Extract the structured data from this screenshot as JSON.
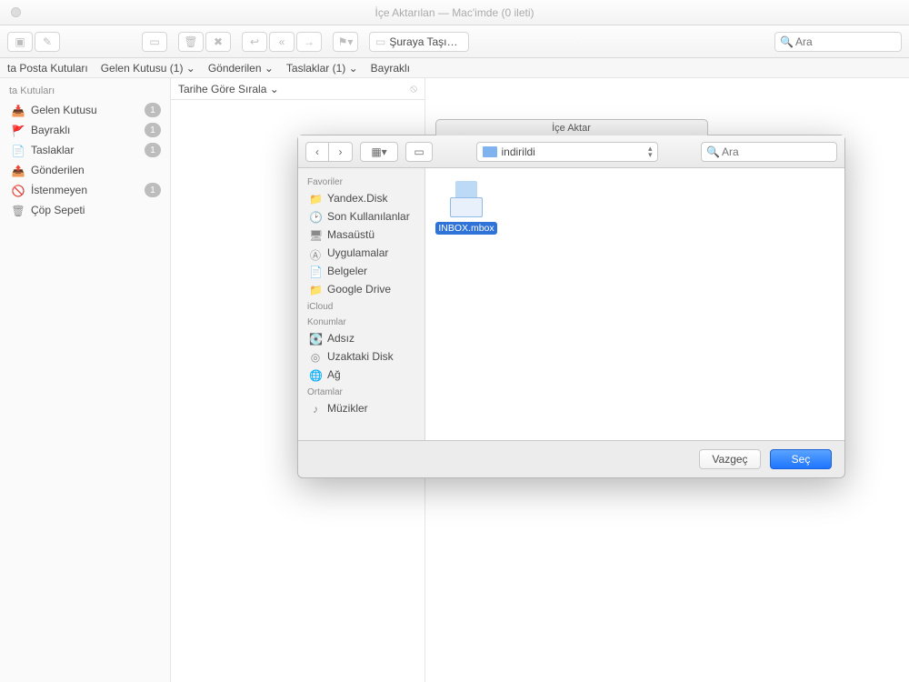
{
  "window": {
    "title": "İçe Aktarılan — Mac'imde (0 ileti)"
  },
  "toolbar": {
    "search_placeholder": "Ara"
  },
  "favbar": {
    "items": [
      "ta Posta Kutuları",
      "Gelen Kutusu (1) ⌄",
      "Gönderilen ⌄",
      "Taslaklar (1) ⌄",
      "Bayraklı"
    ]
  },
  "sidebar": {
    "header": "ta Kutuları",
    "items": [
      {
        "icon": "📥",
        "label": "Gelen Kutusu",
        "badge": "1"
      },
      {
        "icon": "🚩",
        "label": "Bayraklı",
        "badge": "1"
      },
      {
        "icon": "📄",
        "label": "Taslaklar",
        "badge": "1"
      },
      {
        "icon": "📤",
        "label": "Gönderilen",
        "badge": ""
      },
      {
        "icon": "🚫",
        "label": "İstenmeyen",
        "badge": "1"
      },
      {
        "icon": "🗑",
        "label": "Çöp Sepeti",
        "badge": ""
      }
    ]
  },
  "msglist": {
    "sort_label": "Tarihe Göre Sırala ⌄"
  },
  "move_placeholder": "Şuraya Taşı…",
  "dialog": {
    "title": "İçe Aktar",
    "folder": "indirildi",
    "search_placeholder": "Ara",
    "sections": [
      {
        "title": "Favoriler",
        "items": [
          {
            "icon": "📁",
            "label": "Yandex.Disk"
          },
          {
            "icon": "🕑",
            "label": "Son Kullanılanlar"
          },
          {
            "icon": "🖥",
            "label": "Masaüstü"
          },
          {
            "icon": "Ⓐ",
            "label": "Uygulamalar"
          },
          {
            "icon": "📄",
            "label": "Belgeler"
          },
          {
            "icon": "📁",
            "label": "Google Drive"
          }
        ]
      },
      {
        "title": "iCloud",
        "items": []
      },
      {
        "title": "Konumlar",
        "items": [
          {
            "icon": "💽",
            "label": "Adsız"
          },
          {
            "icon": "◎",
            "label": "Uzaktaki Disk"
          },
          {
            "icon": "🌐",
            "label": "Ağ"
          }
        ]
      },
      {
        "title": "Ortamlar",
        "items": [
          {
            "icon": "♪",
            "label": "Müzikler"
          }
        ]
      }
    ],
    "file": {
      "name": "INBOX.mbox"
    },
    "cancel": "Vazgeç",
    "choose": "Seç"
  }
}
